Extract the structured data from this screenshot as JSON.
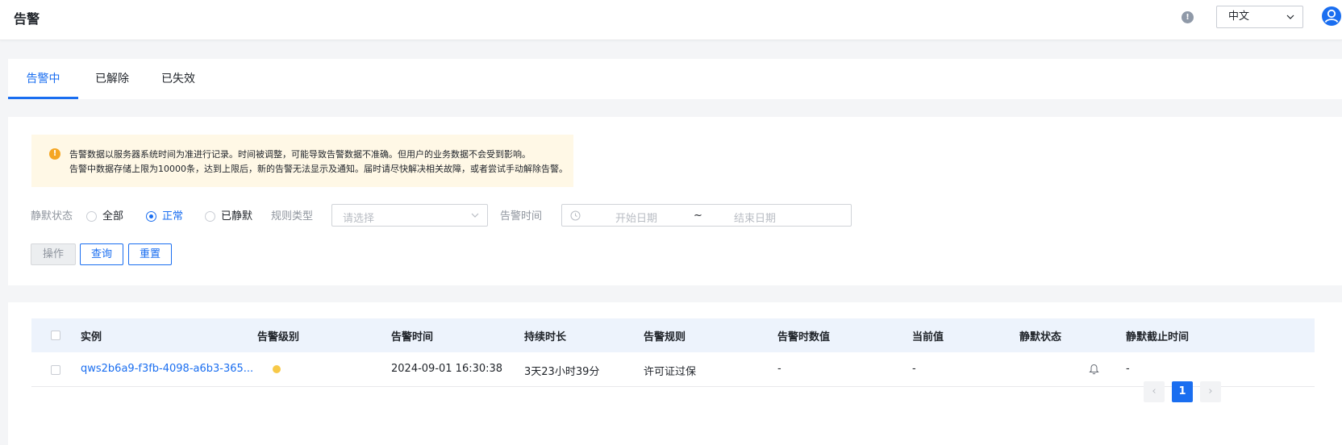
{
  "header": {
    "title": "告警",
    "language": "中文"
  },
  "tabs": [
    {
      "label": "告警中",
      "active": true
    },
    {
      "label": "已解除",
      "active": false
    },
    {
      "label": "已失效",
      "active": false
    }
  ],
  "notice": {
    "line1": "告警数据以服务器系统时间为准进行记录。时间被调整，可能导致告警数据不准确。但用户的业务数据不会受到影响。",
    "line2": "告警中数据存储上限为10000条，达到上限后，新的告警无法显示及通知。届时请尽快解决相关故障，或者尝试手动解除告警。"
  },
  "filters": {
    "silence_label": "静默状态",
    "silence_options": [
      {
        "label": "全部",
        "checked": false
      },
      {
        "label": "正常",
        "checked": true
      },
      {
        "label": "已静默",
        "checked": false
      }
    ],
    "rule_type_label": "规则类型",
    "rule_type_placeholder": "请选择",
    "alarm_time_label": "告警时间",
    "start_placeholder": "开始日期",
    "range_separator": "~",
    "end_placeholder": "结束日期"
  },
  "buttons": {
    "action": "操作",
    "query": "查询",
    "reset": "重置"
  },
  "table": {
    "columns": [
      "实例",
      "告警级别",
      "告警时间",
      "持续时长",
      "告警规则",
      "告警时数值",
      "当前值",
      "静默状态",
      "静默截止时间"
    ],
    "rows": [
      {
        "instance": "qws2b6a9-f3fb-4098-a6b3-365...",
        "level_color": "#f7c948",
        "alarm_time": "2024-09-01 16:30:38",
        "duration": "3天23小时39分",
        "rule": "许可证过保",
        "alarm_value": "-",
        "current_value": "-",
        "silence_icon": "bell-icon",
        "silence_end": "-"
      }
    ]
  },
  "pagination": {
    "prev": "‹",
    "current": "1",
    "next": "›"
  },
  "colors": {
    "primary": "#1a6ef0",
    "warning": "#f5a623",
    "notice_bg": "#fff8e6",
    "table_header_bg": "#edf3fc"
  }
}
